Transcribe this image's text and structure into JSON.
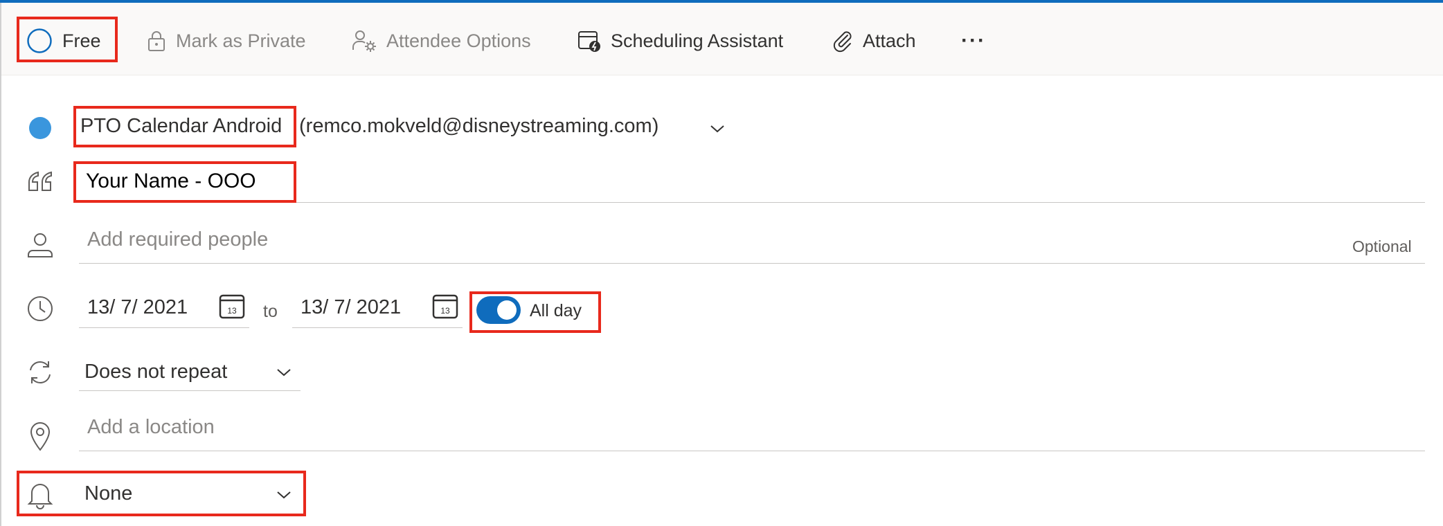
{
  "toolbar": {
    "free_label": "Free",
    "private_label": "Mark as Private",
    "attendee_label": "Attendee Options",
    "scheduling_label": "Scheduling Assistant",
    "attach_label": "Attach",
    "more_label": "···"
  },
  "calendar": {
    "name": "PTO Calendar Android",
    "account": "(remco.mokveld@disneystreaming.com)",
    "color": "#3a96dd"
  },
  "title": {
    "value": "Your Name - OOO"
  },
  "people": {
    "placeholder": "Add required people",
    "optional_label": "Optional"
  },
  "datetime": {
    "start_date": "13/ 7/ 2021",
    "to_label": "to",
    "end_date": "13/ 7/ 2021",
    "calendar_icon_day": "13",
    "all_day_label": "All day",
    "all_day_on": true
  },
  "repeat": {
    "value": "Does not repeat"
  },
  "location": {
    "placeholder": "Add a location"
  },
  "reminder": {
    "value": "None"
  },
  "colors": {
    "accent": "#0f6cbd",
    "highlight": "#e8291c",
    "toggle_on": "#0f6cbd"
  }
}
